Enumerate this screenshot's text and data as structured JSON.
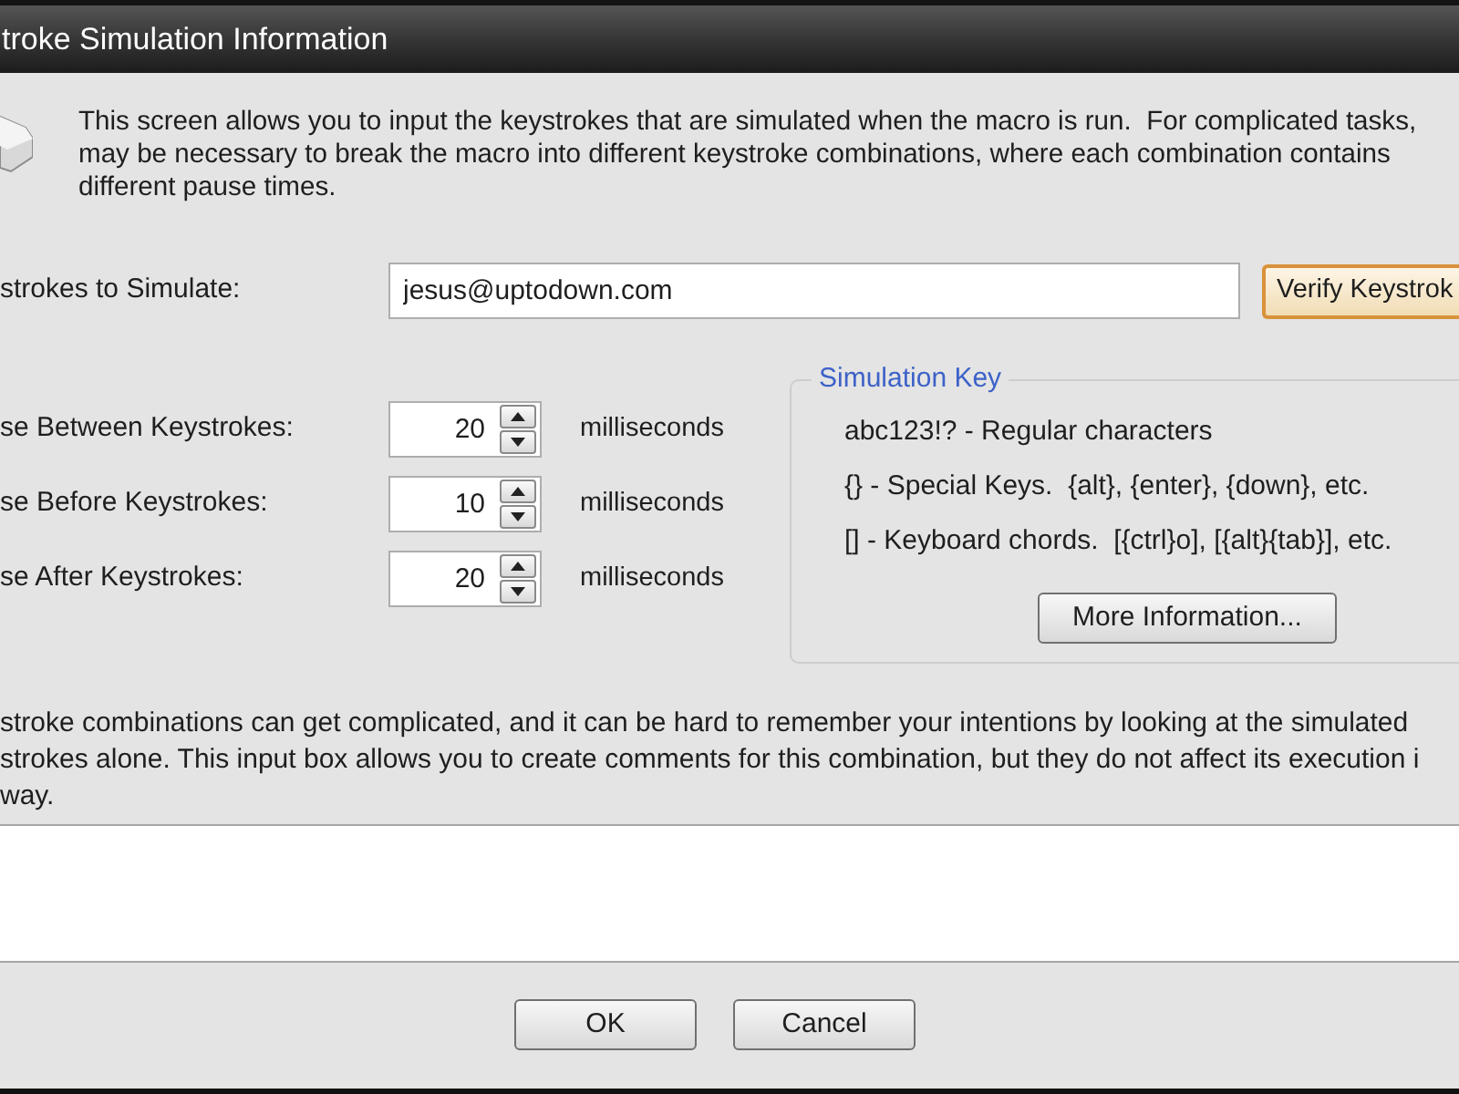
{
  "window": {
    "title": "troke Simulation Information"
  },
  "intro": {
    "lines": [
      "This screen allows you to input the keystrokes that are simulated when the macro is run.  For complicated tasks,",
      "may be necessary to break the macro into different keystroke combinations, where each combination contains",
      "different pause times."
    ]
  },
  "keystrokes": {
    "label": "strokes to Simulate:",
    "value": "jesus@uptodown.com"
  },
  "verify_button": {
    "label": "Verify Keystrok",
    "focused": true
  },
  "pauses": [
    {
      "label": "se Between Keystrokes:",
      "value": "20",
      "unit": "milliseconds"
    },
    {
      "label": "se Before Keystrokes:",
      "value": "10",
      "unit": "milliseconds"
    },
    {
      "label": "se After Keystrokes:",
      "value": "20",
      "unit": "milliseconds"
    }
  ],
  "simulation_key": {
    "title": "Simulation Key",
    "lines": [
      "abc123!? - Regular characters",
      "{} - Special Keys.  {alt}, {enter}, {down}, etc.",
      "[] - Keyboard chords.  [{ctrl}o], [{alt}{tab}], etc."
    ],
    "button": "More Information..."
  },
  "comments_help": {
    "lines": [
      "stroke combinations can get complicated, and it can be hard to remember your intentions by looking at the simulated",
      "strokes alone. This input box allows you to create comments for this combination, but they do not affect its execution i",
      "way."
    ]
  },
  "buttons": [
    "OK",
    "Cancel"
  ]
}
